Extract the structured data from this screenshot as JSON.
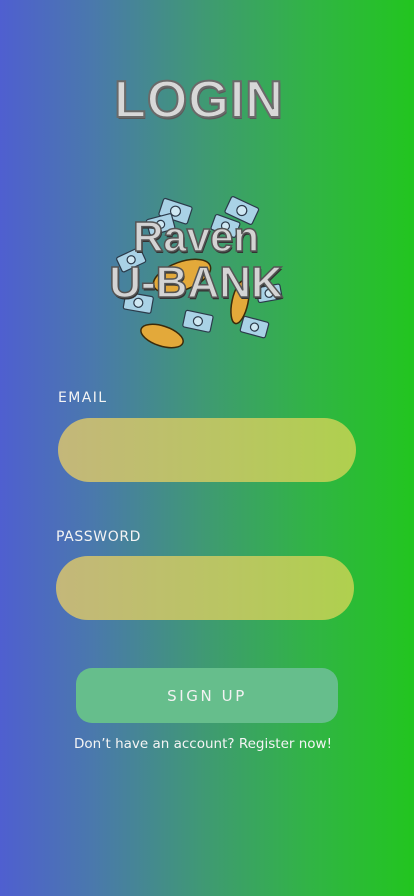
{
  "page": {
    "title": "LOGIN"
  },
  "logo": {
    "line1": "Raven",
    "line2": "U-BANK",
    "icon": "money-coins-illustration"
  },
  "form": {
    "email_label": "EMAIL",
    "email_value": "",
    "email_placeholder": "",
    "password_label": "PASSWORD",
    "password_value": "",
    "password_placeholder": "",
    "submit_label": "SIGN UP",
    "register_text": "Don’t have an account? Register now!"
  },
  "colors": {
    "background_start": "#4f5fd0",
    "background_end": "#22c51f",
    "input_fill": "#bcc268",
    "button_fill": "#66be8c",
    "title_fill": "#d8d8d8"
  }
}
